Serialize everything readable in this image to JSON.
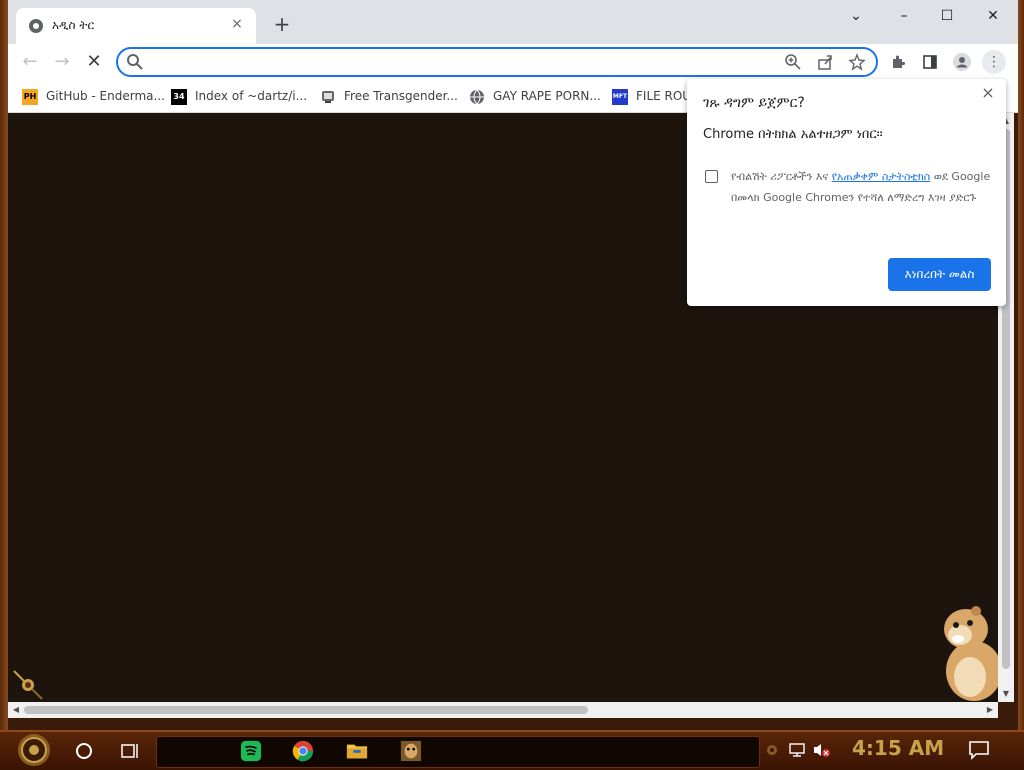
{
  "browser": {
    "tab": {
      "title": "አዲስ ትር",
      "close_icon": "×"
    },
    "newtab_icon": "+",
    "window_controls": {
      "minimize": "–",
      "maximize": "☐",
      "close": "✕",
      "dropdown": "⌄"
    },
    "omnibox": {
      "value": "",
      "placeholder": ""
    }
  },
  "bookmarks": [
    {
      "label": "GitHub - Enderma...",
      "favicon": "PH"
    },
    {
      "label": "Index of ~dartz/i...",
      "favicon": "34"
    },
    {
      "label": "Free Transgender...",
      "favicon": "globe-icon"
    },
    {
      "label": "GAY RAPE PORN...",
      "favicon": "globe-icon"
    },
    {
      "label": "FILE ROU",
      "favicon": "MFT"
    }
  ],
  "popup": {
    "title": "ገጹ ዳግም ይጀምር?",
    "message": "Chrome በትክክል አልተዘጋም ነበር።",
    "checkbox_text_before": "የብልሽት ሪፖርቶችን እና ",
    "checkbox_link": "የአጠቃቀም ስታትስቲክስ",
    "checkbox_text_after": " ወደ Google በመላክ Google Chromeን የተሻለ ለማድረግ እገዛ ያድርጉ",
    "checkbox_checked": false,
    "button_label": "እነበረበት መልስ",
    "close_icon": "×"
  },
  "taskbar": {
    "clock": "4:15 AM",
    "pinned": [
      "spotify-icon",
      "chrome-icon",
      "file-explorer-icon",
      "game-icon"
    ]
  },
  "colors": {
    "accent": "#1a73e8",
    "content_bg": "#1d140e",
    "clock": "#c8a24a"
  }
}
